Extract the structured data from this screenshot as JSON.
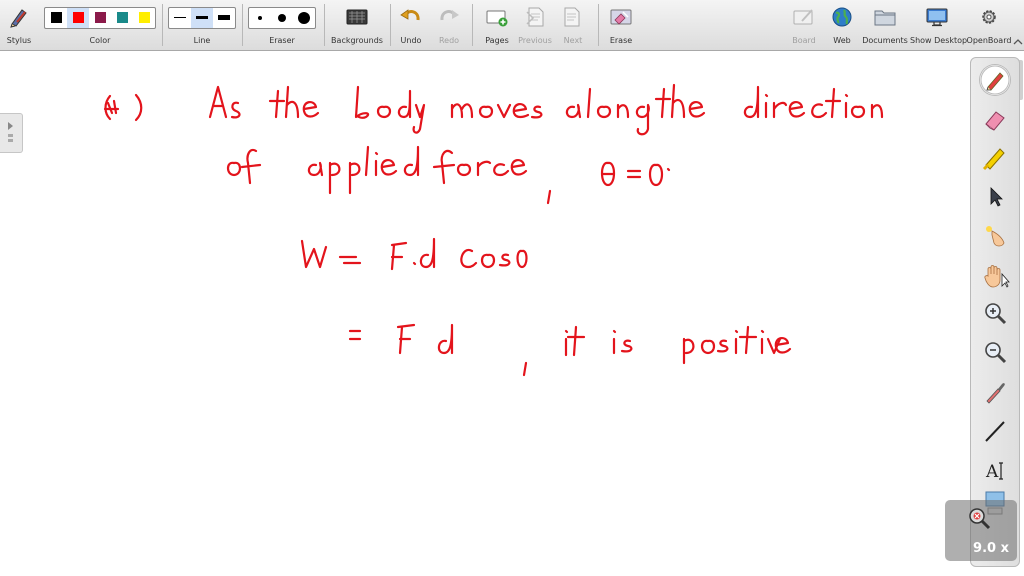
{
  "toolbar": {
    "stylus": "Stylus",
    "color": "Color",
    "line": "Line",
    "eraser": "Eraser",
    "backgrounds": "Backgrounds",
    "undo": "Undo",
    "redo": "Redo",
    "pages": "Pages",
    "previous": "Previous",
    "next": "Next",
    "erase": "Erase",
    "board": "Board",
    "web": "Web",
    "documents": "Documents",
    "show_desktop": "Show Desktop",
    "openboard": "OpenBoard"
  },
  "palette_colors": [
    "#000000",
    "#ff0000",
    "#8b1a4a",
    "#1a8a8a",
    "#ffee00"
  ],
  "selected_color": "#ff0000",
  "ink_color": "#e3141c",
  "handwriting": {
    "line1": "(ii) As the body moves along the direction",
    "line2": "of applied force , θ = 0",
    "line3": "W = F.d Cosθ",
    "line4": "= F d , it is positive"
  },
  "side_tools": [
    "pen-icon",
    "eraser-icon",
    "highlighter-icon",
    "pointer-icon",
    "laser-pointer-icon",
    "hand-icon",
    "zoom-in-icon",
    "zoom-out-icon",
    "pipette-icon",
    "line-icon",
    "text-icon",
    "capture-icon"
  ],
  "zoom_level": "9.0 x"
}
